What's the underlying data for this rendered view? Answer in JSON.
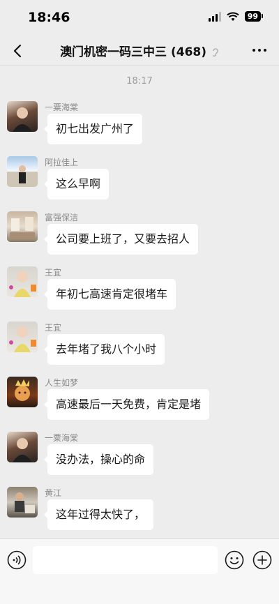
{
  "status_bar": {
    "time": "18:46",
    "battery": "99",
    "icons": [
      "signal-icon",
      "wifi-icon",
      "battery-icon"
    ]
  },
  "nav": {
    "title": "澳门机密一码三中三 (468)",
    "icons": [
      "back-icon",
      "ear-icon",
      "more-icon"
    ]
  },
  "chat": {
    "timestamp": "18:17",
    "messages": [
      {
        "sender": "一粟海棠",
        "text": "初七出发广州了"
      },
      {
        "sender": "阿拉佳上",
        "text": "这么早啊"
      },
      {
        "sender": "富强保洁",
        "text": "公司要上班了，又要去招人"
      },
      {
        "sender": "王宜",
        "text": "年初七高速肯定很堵车"
      },
      {
        "sender": "王宜",
        "text": "去年堵了我八个小时"
      },
      {
        "sender": "人生如梦",
        "text": "高速最后一天免费，肯定是堵"
      },
      {
        "sender": "一粟海棠",
        "text": "没办法，操心的命"
      },
      {
        "sender": "黄江",
        "text": "这年过得太快了，"
      }
    ]
  },
  "input_bar": {
    "icons": [
      "voice-icon",
      "emoji-icon",
      "plus-icon"
    ]
  },
  "colors": {
    "background": "#ededed",
    "bubble": "#ffffff",
    "sender": "#8a8a8a"
  }
}
